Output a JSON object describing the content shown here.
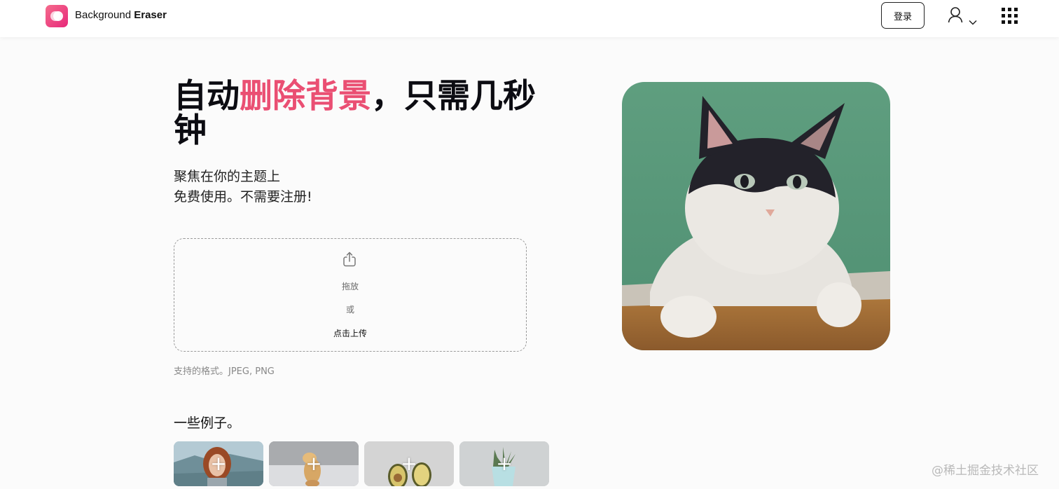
{
  "header": {
    "brand_regular": "Background",
    "brand_bold": "Eraser",
    "login_label": "登录"
  },
  "hero": {
    "title_part1": "自动",
    "title_highlight": "删除背景",
    "title_part2": "，只需几秒钟",
    "subtitle_line1": "聚焦在你的主题上",
    "subtitle_line2": "免费使用。不需要注册!"
  },
  "upload": {
    "drag_label": "拖放",
    "or_label": "或",
    "click_label": "点击上传",
    "formats_text": "支持的格式。JPEG, PNG"
  },
  "examples": {
    "title": "一些例子。",
    "items": [
      {
        "plus": "+",
        "subject": "woman portrait"
      },
      {
        "plus": "+",
        "subject": "dog"
      },
      {
        "plus": "+",
        "subject": "avocado"
      },
      {
        "plus": "+",
        "subject": "potted plant"
      }
    ]
  },
  "watermark": "@稀土掘金技术社区",
  "colors": {
    "accent": "#ea4f73",
    "logo_start": "#f56b8c",
    "logo_end": "#e7287a"
  },
  "icons": {
    "user": "user-icon",
    "menu": "apps-grid-icon",
    "upload": "upload-icon"
  }
}
